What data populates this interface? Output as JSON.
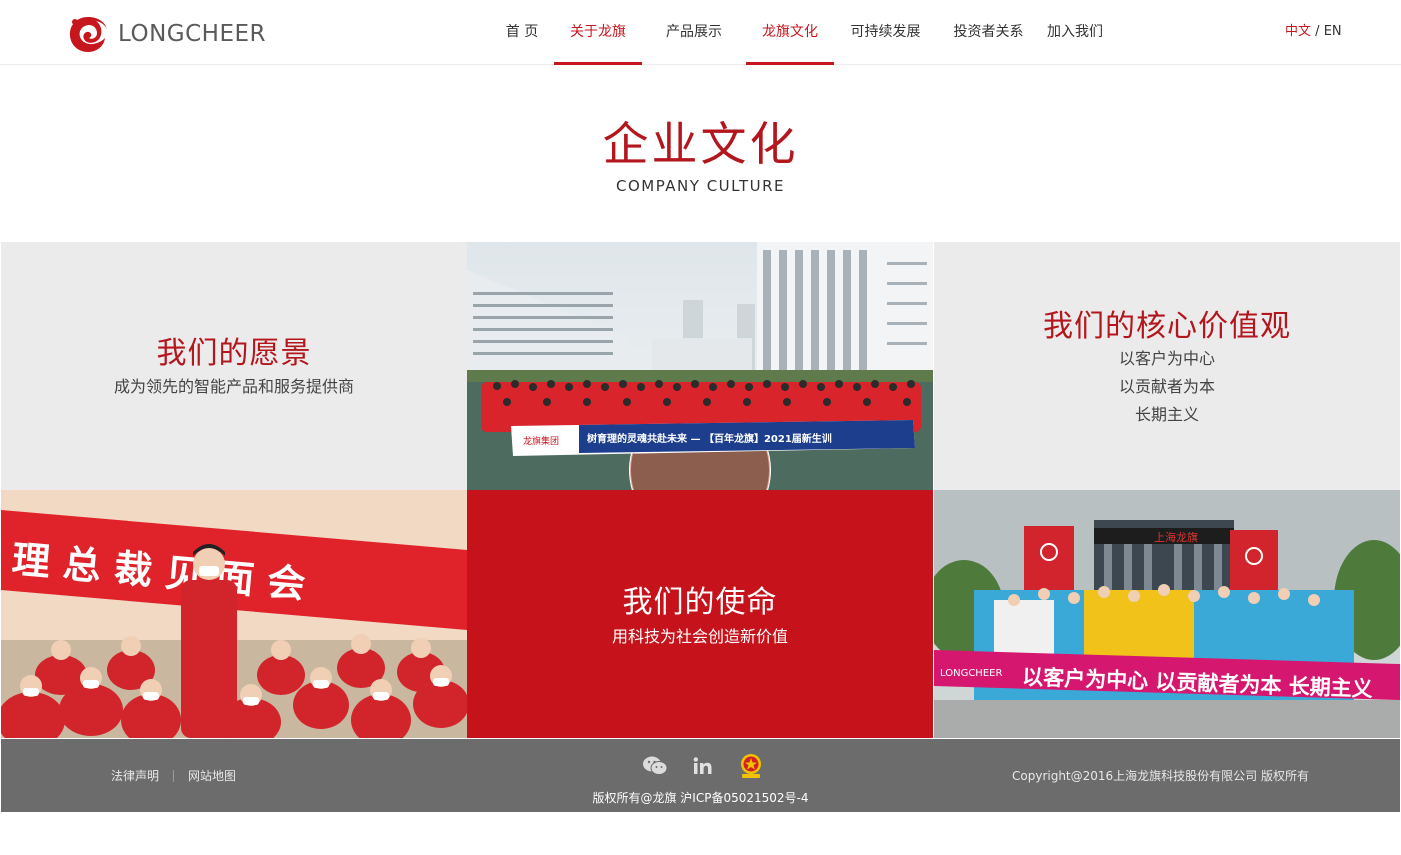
{
  "brand": {
    "logo_text": "LONGCHEER",
    "accent": "#c6171e"
  },
  "nav": {
    "items": [
      {
        "label": "首 页",
        "active": false
      },
      {
        "label": "关于龙旗",
        "active": true
      },
      {
        "label": "产品展示",
        "active": false
      },
      {
        "label": "龙旗文化",
        "active": true
      },
      {
        "label": "可持续发展",
        "active": false
      },
      {
        "label": "投资者关系",
        "active": false
      },
      {
        "label": "加入我们",
        "active": false
      }
    ],
    "lang_zh": "中文",
    "lang_sep": "/",
    "lang_en": "EN"
  },
  "page": {
    "title_zh": "企业文化",
    "title_en": "COMPANY CULTURE"
  },
  "vision": {
    "title": "我们的愿景",
    "text": "成为领先的智能产品和服务提供商"
  },
  "values": {
    "title": "我们的核心价值观",
    "lines": [
      "以客户为中心",
      "以贡献者为本",
      "长期主义"
    ]
  },
  "mission": {
    "title": "我们的使命",
    "text": "用科技为社会创造新价值"
  },
  "photos": {
    "group_banner": "树育理的灵魂共赴未来 — 【百年龙旗】2021届新生训",
    "meeting_banner": "理 总 裁 见 面 会",
    "office_banner": "以客户为中心 以贡献者为本 长期主义",
    "office_logo": "LONGCHEER"
  },
  "footer": {
    "legal": "法律声明",
    "sitemap": "网站地图",
    "icp": "版权所有@龙旗 沪ICP备05021502号-4",
    "copyright": "Copyright@2016上海龙旗科技股份有限公司 版权所有"
  }
}
